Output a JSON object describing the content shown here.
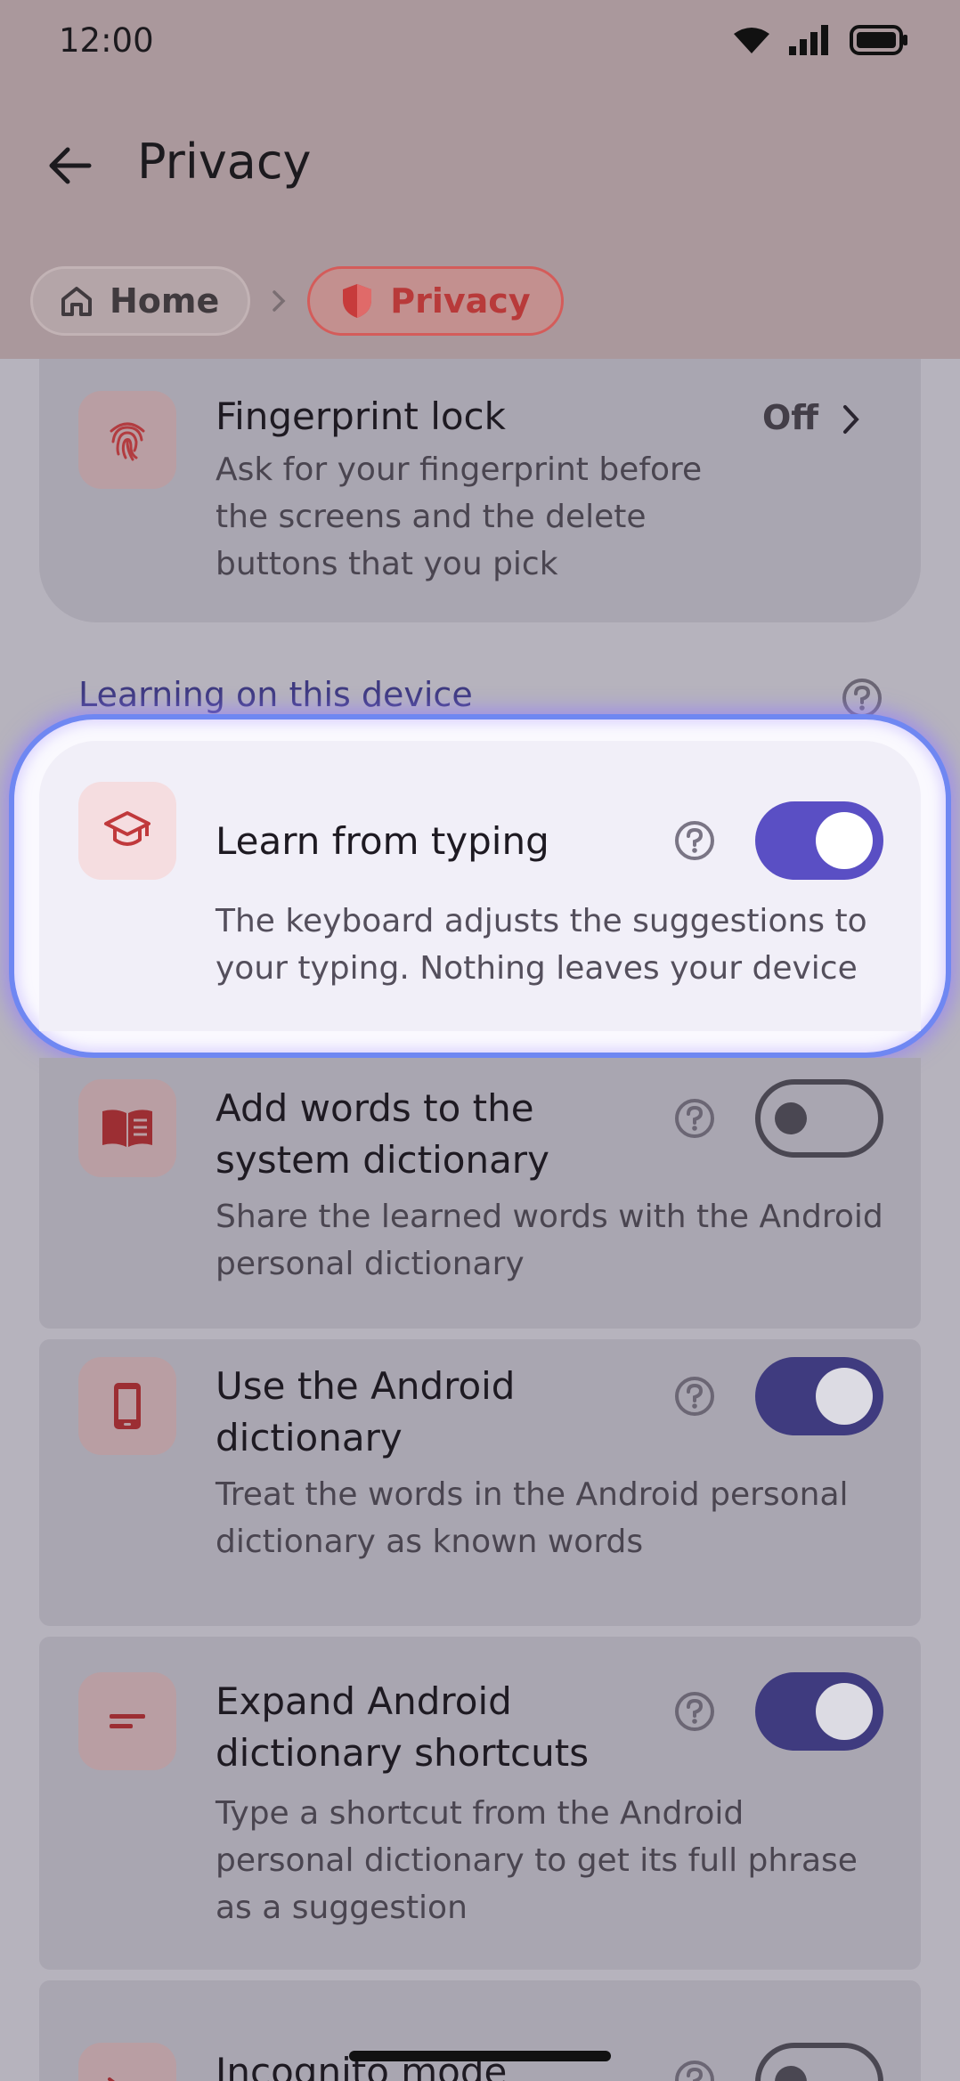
{
  "status_bar": {
    "time": "12:00"
  },
  "topbar": {
    "title": "Privacy"
  },
  "breadcrumb": {
    "home": "Home",
    "current": "Privacy"
  },
  "fingerprint": {
    "title": "Fingerprint lock",
    "value": "Off",
    "desc_lines": [
      "Ask for your fingerprint before",
      "the screens and the delete",
      "buttons that you pick"
    ]
  },
  "section": {
    "title": "Learning on this device"
  },
  "settings": [
    {
      "title_lines": [
        "Learn from typing"
      ],
      "desc_lines": [
        "The keyboard adjusts the suggestions to",
        "your typing. Nothing leaves your device"
      ],
      "enabled": true,
      "icon": "graduation-cap-icon"
    },
    {
      "title_lines": [
        "Add words to the",
        "system dictionary"
      ],
      "desc_lines": [
        "Share the learned words with the Android",
        "personal dictionary"
      ],
      "enabled": false,
      "icon": "book-icon"
    },
    {
      "title_lines": [
        "Use the Android",
        "dictionary"
      ],
      "desc_lines": [
        "Treat the words in the Android personal",
        "dictionary as known words"
      ],
      "enabled": true,
      "icon": "phone-icon"
    },
    {
      "title_lines": [
        "Expand Android",
        "dictionary shortcuts"
      ],
      "desc_lines": [
        "Type a shortcut from the Android",
        "personal dictionary to get its full phrase",
        "as a suggestion"
      ],
      "enabled": true,
      "icon": "short-text-icon"
    },
    {
      "title_lines": [
        "Incognito mode"
      ],
      "desc_lines": [],
      "enabled": false,
      "icon": "incognito-icon"
    }
  ],
  "colors": {
    "accent": "#5a4fc4",
    "icon_red": "#c0393c",
    "header": "#aa989c"
  }
}
